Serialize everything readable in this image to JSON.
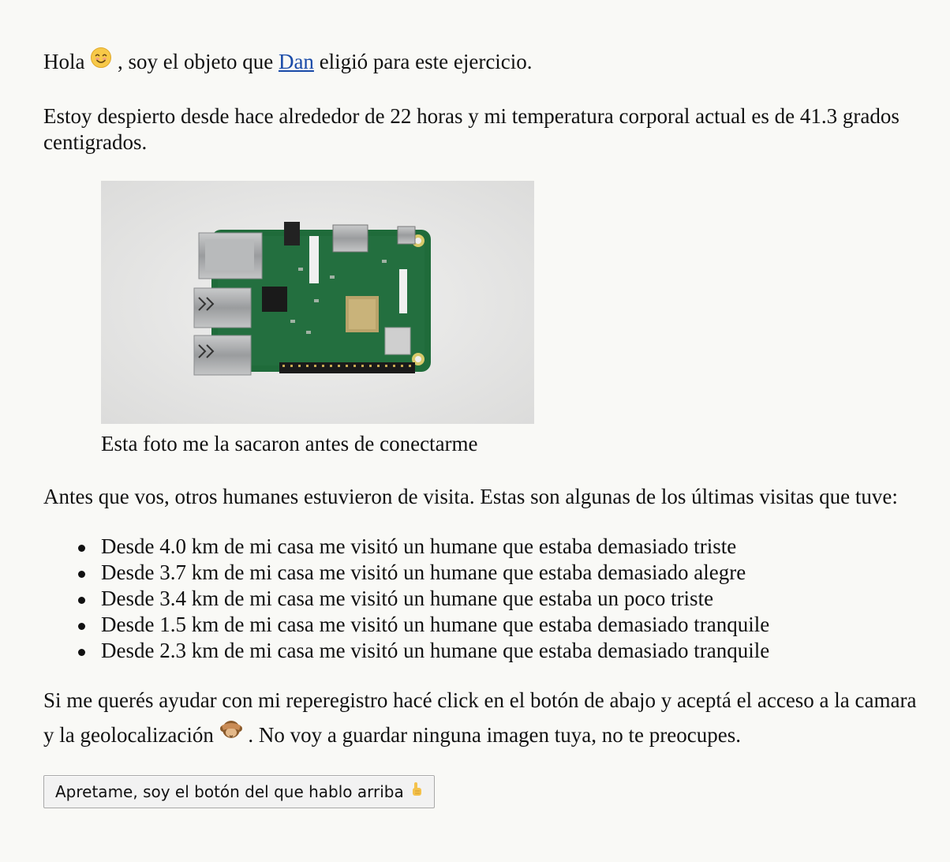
{
  "greeting": {
    "hola": "Hola",
    "emoji_icon": "smiling-face-icon",
    "after_emoji": ", soy el objeto que",
    "link_text": "Dan",
    "after_link": "eligió para este ejercicio."
  },
  "status": {
    "text": "Estoy despierto desde hace alrededor de 22 horas y mi temperatura corporal actual es de 41.3 grados centigrados."
  },
  "photo": {
    "alt": "Raspberry Pi",
    "caption": "Esta foto me la sacaron antes de conectarme"
  },
  "intro": {
    "text": "Antes que vos, otros humanes estuvieron de visita. Estas son algunas de los últimas visitas que tuve:"
  },
  "visits": [
    {
      "text": "Desde 4.0 km de mi casa me visitó un humane que estaba demasiado triste"
    },
    {
      "text": "Desde 3.7 km de mi casa me visitó un humane que estaba demasiado alegre"
    },
    {
      "text": "Desde 3.4 km de mi casa me visitó un humane que estaba un poco triste"
    },
    {
      "text": "Desde 1.5 km de mi casa me visitó un humane que estaba demasiado tranquile"
    },
    {
      "text": "Desde 2.3 km de mi casa me visitó un humane que estaba demasiado tranquile"
    }
  ],
  "help": {
    "before_emoji": "Si me querés ayudar con mi reperegistro hacé click en el botón de abajo y aceptá el acceso a la camara y la geolocalización",
    "emoji_icon": "see-no-evil-monkey-icon",
    "after_emoji": ". No voy a guardar ninguna imagen tuya, no te preocupes."
  },
  "button": {
    "label": "Apretame, soy el botón del que hablo arriba",
    "emoji_icon": "pointing-up-hand-icon"
  }
}
